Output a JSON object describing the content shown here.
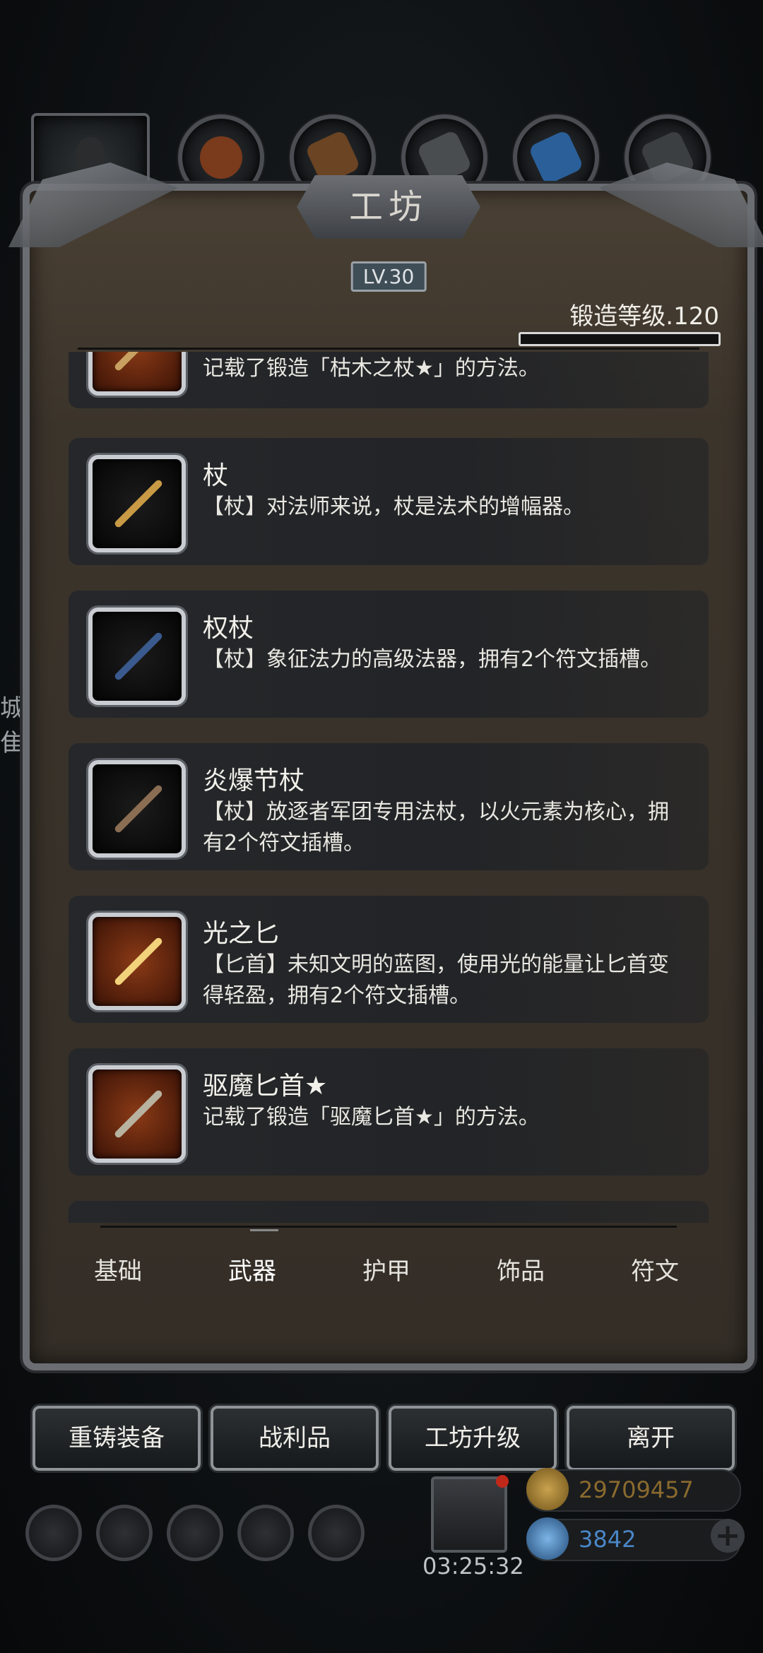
{
  "header": {
    "title": "工坊",
    "level_badge": "LV.30",
    "forge_level": "锻造等级.120",
    "forge_progress": 0.0
  },
  "items": [
    {
      "name": "",
      "desc": "记载了锻造「枯木之杖★」的方法。",
      "icon": "dry-wood-staff-icon"
    },
    {
      "name": "杖",
      "desc": "【杖】对法师来说，杖是法术的增幅器。",
      "icon": "staff-icon"
    },
    {
      "name": "权杖",
      "desc": "【杖】象征法力的高级法器，拥有2个符文插槽。",
      "icon": "scepter-icon"
    },
    {
      "name": "炎爆节杖",
      "desc": "【杖】放逐者军团专用法杖，以火元素为核心，拥有2个符文插槽。",
      "icon": "flame-scepter-icon"
    },
    {
      "name": "光之匕",
      "desc": "【匕首】未知文明的蓝图，使用光的能量让匕首变得轻盈，拥有2个符文插槽。",
      "icon": "light-dagger-icon"
    },
    {
      "name": "驱魔匕首★",
      "desc": "记载了锻造「驱魔匕首★」的方法。",
      "icon": "exorcism-dagger-icon"
    }
  ],
  "tabs": [
    "基础",
    "武器",
    "护甲",
    "饰品",
    "符文"
  ],
  "active_tab": "武器",
  "buttons": {
    "recast": "重铸装备",
    "loot": "战利品",
    "upgrade": "工坊升级",
    "leave": "离开"
  },
  "status": {
    "timer": "03:25:32",
    "gold": "29709457",
    "gems": "3842"
  },
  "side_text": "城隹",
  "colors": {
    "gold_text": "#8a6a2e",
    "gem_text": "#4a86c6",
    "accent_orange": "#c2581f"
  }
}
